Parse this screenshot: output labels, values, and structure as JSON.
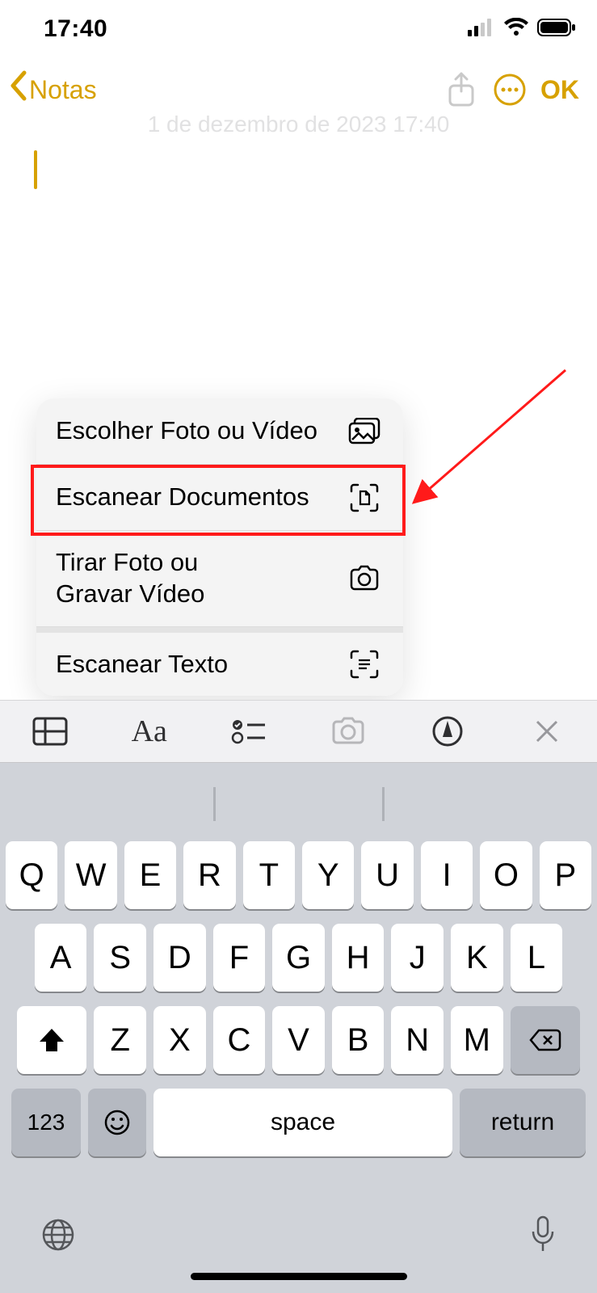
{
  "status": {
    "time": "17:40"
  },
  "nav": {
    "back_label": "Notas",
    "ok_label": "OK"
  },
  "note": {
    "date_line": "1 de dezembro de 2023 17:40"
  },
  "menu": {
    "items": [
      {
        "label": "Escolher Foto ou Vídeo",
        "icon": "photos-icon"
      },
      {
        "label": "Escanear Documentos",
        "icon": "doc-scan-icon"
      },
      {
        "label": "Tirar Foto ou\nGravar Vídeo",
        "icon": "camera-icon"
      },
      {
        "label": "Escanear Texto",
        "icon": "text-scan-icon"
      }
    ],
    "highlighted_index": 1
  },
  "keyboard": {
    "row1": [
      "Q",
      "W",
      "E",
      "R",
      "T",
      "Y",
      "U",
      "I",
      "O",
      "P"
    ],
    "row2": [
      "A",
      "S",
      "D",
      "F",
      "G",
      "H",
      "J",
      "K",
      "L"
    ],
    "row3": [
      "Z",
      "X",
      "C",
      "V",
      "B",
      "N",
      "M"
    ],
    "numeric_key": "123",
    "space_label": "space",
    "return_label": "return"
  }
}
